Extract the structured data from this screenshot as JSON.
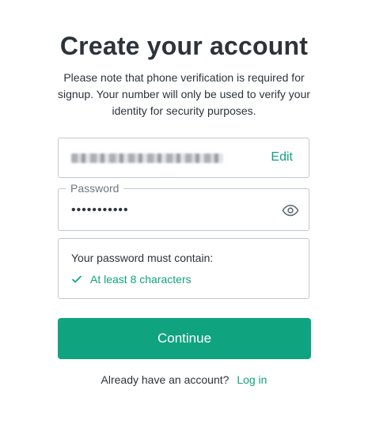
{
  "header": {
    "title": "Create your account",
    "subtitle": "Please note that phone verification is required for signup. Your number will only be used to verify your identity for security purposes."
  },
  "email": {
    "edit_label": "Edit"
  },
  "password": {
    "label": "Password",
    "value": "•••••••••••",
    "icon": "eye-icon"
  },
  "requirements": {
    "title": "Your password must contain:",
    "items": [
      {
        "label": "At least 8 characters",
        "icon": "check-icon"
      }
    ]
  },
  "actions": {
    "continue_label": "Continue"
  },
  "footer": {
    "prompt": "Already have an account?",
    "login_label": "Log in"
  },
  "colors": {
    "accent": "#10a37f",
    "text": "#2d333a",
    "border": "#c2c8d0"
  }
}
